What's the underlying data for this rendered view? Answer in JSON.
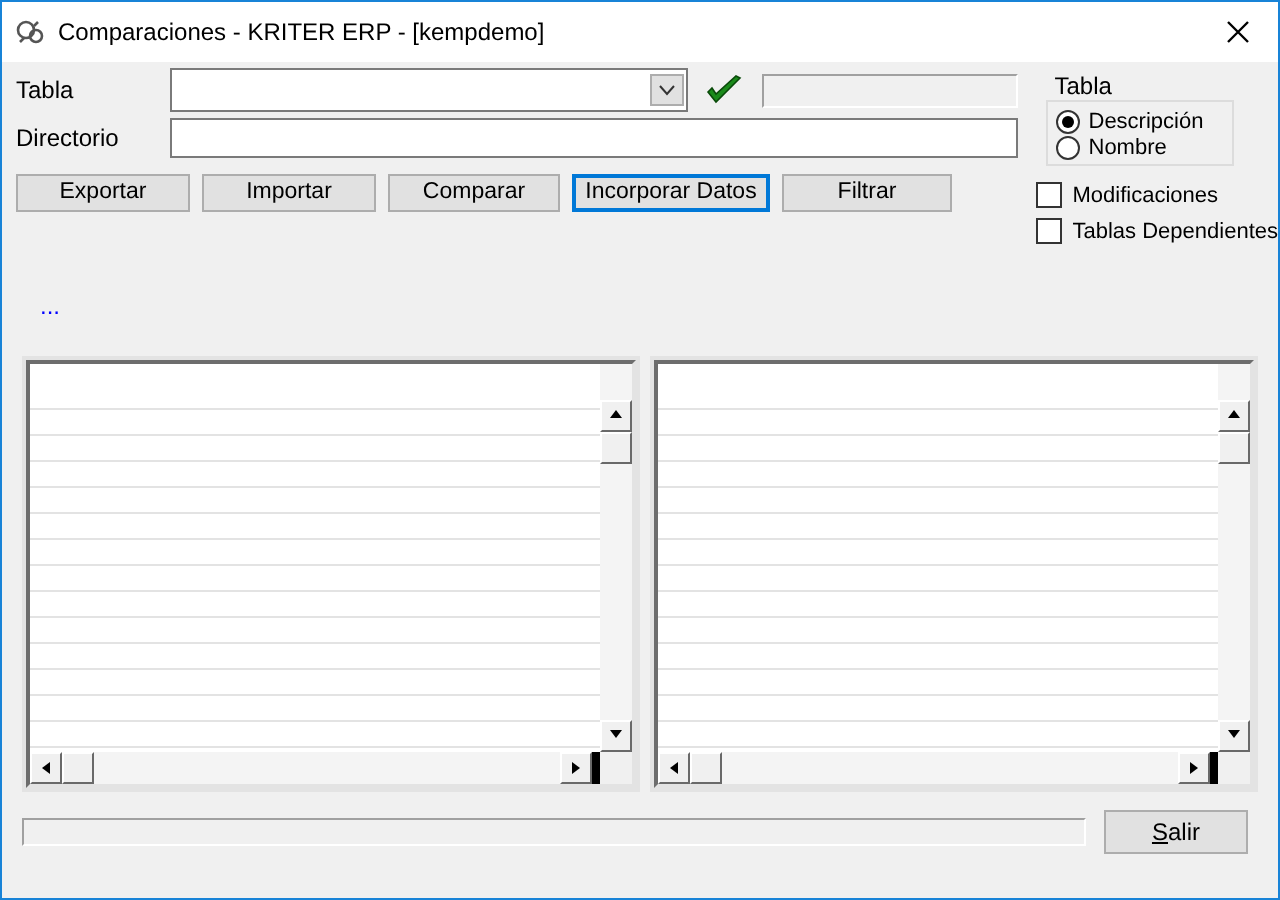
{
  "window": {
    "title": "Comparaciones - KRITER ERP - [kempdemo]"
  },
  "fields": [
    {
      "label": "Tabla",
      "kind": "combo"
    },
    {
      "label": "Directorio",
      "kind": "text"
    }
  ],
  "table_group": {
    "title": "Tabla",
    "options": [
      {
        "label": "Descripción",
        "selected": true
      },
      {
        "label": "Nombre",
        "selected": false
      }
    ]
  },
  "buttons": [
    {
      "label": "Exportar",
      "focused": false
    },
    {
      "label": "Importar",
      "focused": false
    },
    {
      "label": "Comparar",
      "focused": false
    },
    {
      "label": "Incorporar Datos",
      "focused": true
    },
    {
      "label": "Filtrar",
      "focused": false
    }
  ],
  "checkboxes": [
    {
      "label": "Modificaciones",
      "checked": false
    },
    {
      "label": "Tablas Dependientes",
      "checked": false
    }
  ],
  "status": "...",
  "exit_button": {
    "label": "Salir"
  }
}
